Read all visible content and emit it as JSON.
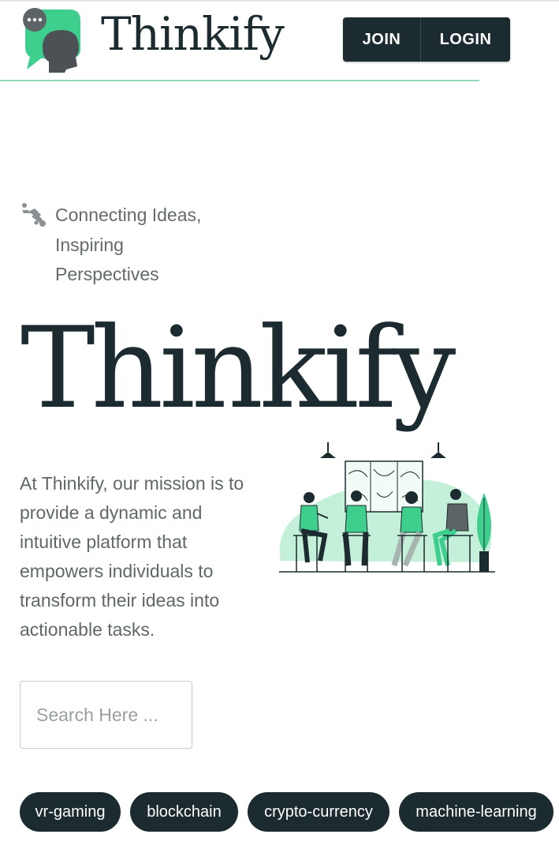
{
  "header": {
    "brand": "Thinkify",
    "buttons": {
      "join": "JOIN",
      "login": "LOGIN"
    }
  },
  "hero": {
    "tagline": [
      "Connecting Ideas,",
      "Inspiring",
      "Perspectives"
    ],
    "title": "Thinkify",
    "mission": "At Thinkify, our mission is to provide a dynamic and intuitive platform that empowers individuals to transform their ideas into actionable tasks."
  },
  "search": {
    "placeholder": "Search Here ..."
  },
  "tags": [
    "vr-gaming",
    "blockchain",
    "crypto-currency",
    "machine-learning"
  ],
  "icons": {
    "logo": "chat-head-icon",
    "tagline": "handshake-icon",
    "illustration": "people-meeting-illustration"
  },
  "colors": {
    "primary_dark": "#1c2b30",
    "accent_green": "#3ecf8e",
    "accent_light": "#8fd9b6",
    "text_gray": "#5f6769"
  }
}
